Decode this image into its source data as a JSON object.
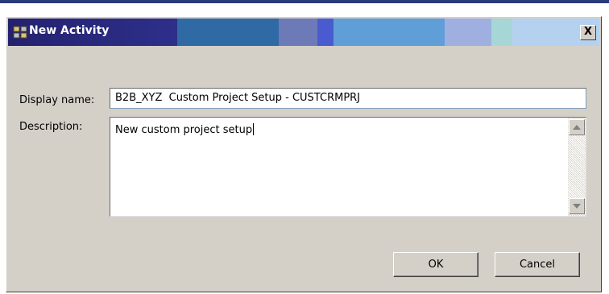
{
  "dialog": {
    "title": "New Activity",
    "title_icon": "activity-window-icon",
    "close_label": "X",
    "title_band_colors": [
      "#2b2d82",
      "#2f6aa5",
      "#6c7bb8",
      "#4a5bd0",
      "#5f9ed6",
      "#9fb0e0",
      "#a6d6d6",
      "#b4d2f0"
    ]
  },
  "form": {
    "display_name_label": "Display name:",
    "display_name_value": "B2B_XYZ  Custom Project Setup - CUSTCRMPRJ",
    "description_label": "Description:",
    "description_value": "New custom project setup"
  },
  "buttons": {
    "ok_label": "OK",
    "cancel_label": "Cancel"
  },
  "icons": {
    "scroll_up": "arrow-up-icon",
    "scroll_down": "arrow-down-icon"
  }
}
